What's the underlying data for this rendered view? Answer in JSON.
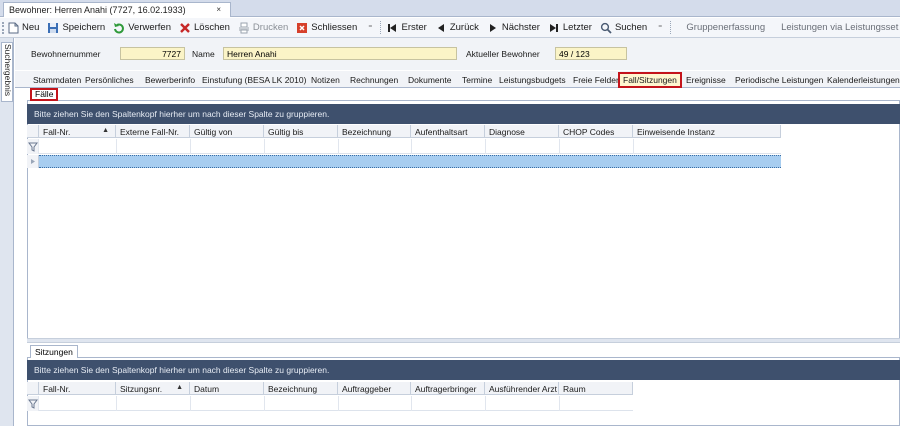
{
  "document_tab": {
    "title": "Bewohner: Herren Anahi (7727, 16.02.1933)",
    "close": "×"
  },
  "toolbar": {
    "new": "Neu",
    "save": "Speichern",
    "discard": "Verwerfen",
    "delete": "Löschen",
    "print": "Drucken",
    "close": "Schliessen",
    "first": "Erster",
    "back": "Zurück",
    "next": "Nächster",
    "last": "Letzter",
    "search": "Suchen",
    "group_entry": "Gruppenerfassung",
    "insert_services": "Leistungen via Leistungsset einfügen"
  },
  "side_panel": {
    "label": "Suchergebnis"
  },
  "resident": {
    "number_label": "Bewohnernummer",
    "number_value": "7727",
    "name_label": "Name",
    "name_value": "Herren Anahi",
    "current_label": "Aktueller Bewohner",
    "current_value": "49 / 123"
  },
  "main_tabs": [
    "Stammdaten",
    "Persönliches",
    "Bewerberinfo",
    "Einstufung (BESA LK 2010)",
    "Notizen",
    "Rechnungen",
    "Dokumente",
    "Termine",
    "Leistungsbudgets",
    "Freie Felder",
    "Fall/Sitzungen",
    "Ereignisse",
    "Periodische Leistungen",
    "Kalenderleistungen"
  ],
  "active_main_tab": "Fall/Sitzungen",
  "cases": {
    "tab_label": "Fälle",
    "group_hint": "Bitte ziehen Sie den Spaltenkopf hierher um nach dieser Spalte zu gruppieren.",
    "columns": [
      "Fall-Nr.",
      "Externe Fall-Nr.",
      "Gültig von",
      "Gültig bis",
      "Bezeichnung",
      "Aufenthaltsart",
      "Diagnose",
      "CHOP Codes",
      "Einweisende Instanz"
    ],
    "sort_indicator": "▲"
  },
  "sessions": {
    "tab_label": "Sitzungen",
    "group_hint": "Bitte ziehen Sie den Spaltenkopf hierher um nach dieser Spalte zu gruppieren.",
    "columns": [
      "Fall-Nr.",
      "Sitzungsnr.",
      "Datum",
      "Bezeichnung",
      "Auftraggeber",
      "Auftragerbringer",
      "Ausführender Arzt",
      "Raum"
    ],
    "sort_indicator": "▲"
  },
  "colors": {
    "accent_dark": "#3e506d",
    "highlight_border": "#c4141b",
    "selected_row": "#a7cdf0",
    "field_bg": "#fbf4c7"
  }
}
